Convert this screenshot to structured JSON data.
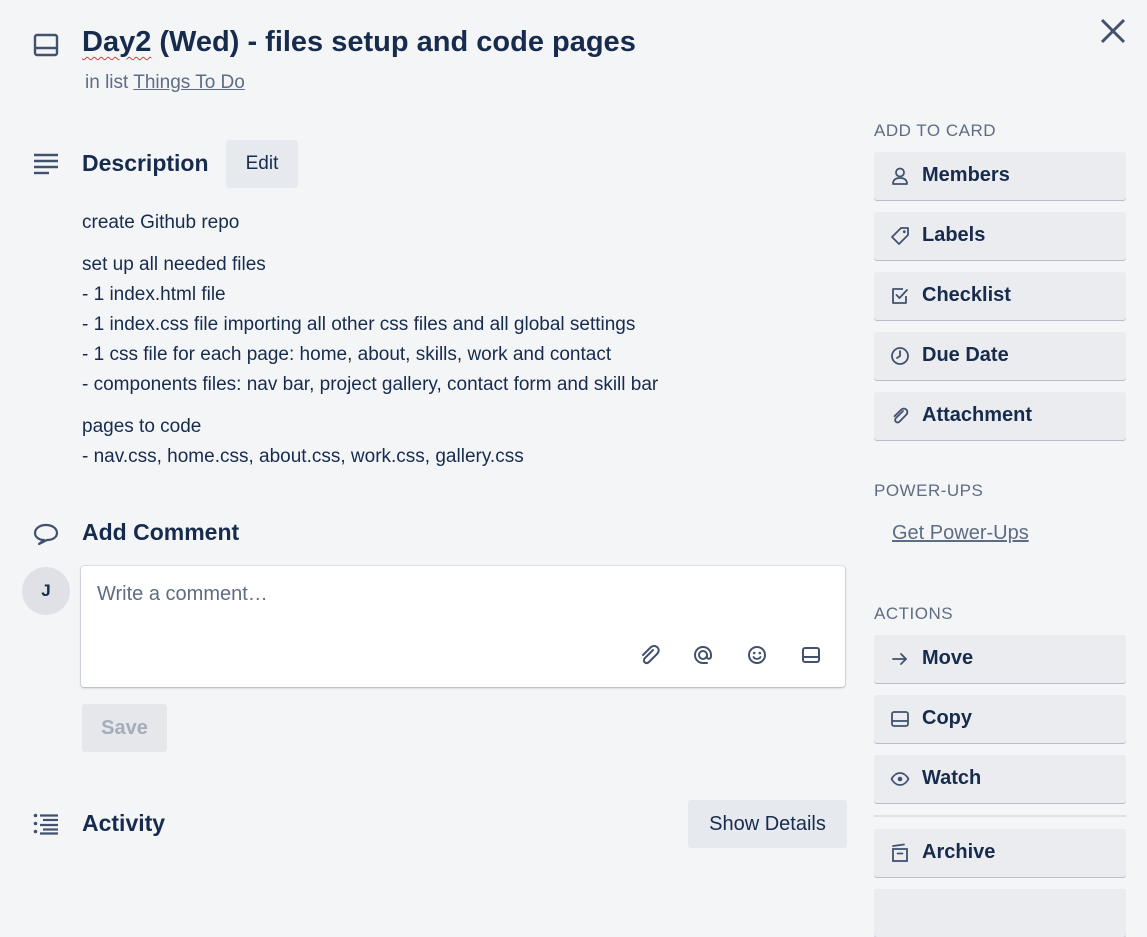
{
  "card": {
    "title_spell": "Day2",
    "title_rest": " (Wed) - files setup and code pages",
    "in_list_prefix": "in list ",
    "list_name": "Things To Do"
  },
  "description": {
    "heading": "Description",
    "edit_label": "Edit",
    "paragraphs": [
      [
        "create Github repo"
      ],
      [
        "set up all needed files",
        "- 1 index.html file",
        "- 1 index.css file importing all other css files and all global settings",
        "- 1 css file for each page: home, about, skills, work and contact",
        "- components files: nav bar, project gallery, contact form and skill bar"
      ],
      [
        "pages to code",
        "- nav.css, home.css, about.css, work.css, gallery.css"
      ]
    ]
  },
  "comment": {
    "heading": "Add Comment",
    "avatar_initial": "J",
    "placeholder": "Write a comment…",
    "save_label": "Save"
  },
  "activity": {
    "heading": "Activity",
    "show_details_label": "Show Details"
  },
  "sidebar": {
    "add_to_card_label": "ADD TO CARD",
    "add_items": [
      {
        "label": "Members",
        "icon": "person-icon"
      },
      {
        "label": "Labels",
        "icon": "tag-icon"
      },
      {
        "label": "Checklist",
        "icon": "checkbox-icon"
      },
      {
        "label": "Due Date",
        "icon": "clock-icon"
      },
      {
        "label": "Attachment",
        "icon": "paperclip-icon"
      }
    ],
    "powerups_label": "POWER-UPS",
    "get_powerups_label": "Get Power-Ups",
    "actions_label": "ACTIONS",
    "action_items": [
      {
        "label": "Move",
        "icon": "arrow-right-icon"
      },
      {
        "label": "Copy",
        "icon": "card-icon"
      },
      {
        "label": "Watch",
        "icon": "eye-icon"
      },
      {
        "label": "Archive",
        "icon": "archive-icon"
      }
    ]
  }
}
